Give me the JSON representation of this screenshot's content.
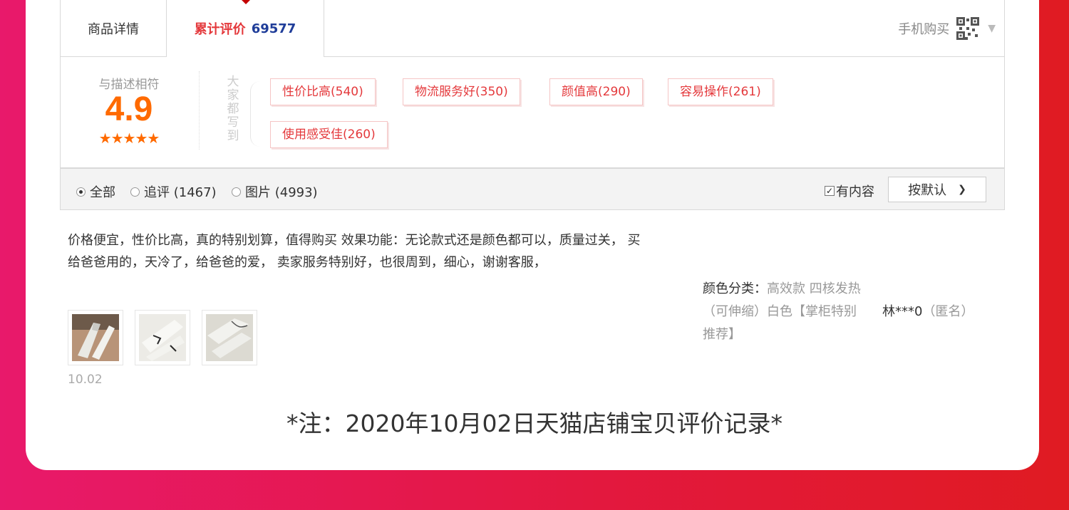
{
  "tabs": {
    "detail": "商品详情",
    "review_label": "累计评价",
    "review_count": "69577",
    "mobile_buy": "手机购买"
  },
  "rating": {
    "label": "与描述相符",
    "score": "4.9",
    "stars": "★★★★★",
    "stars_value": 5,
    "side_label": "大家都写到"
  },
  "tags": [
    {
      "text": "性价比高(540)"
    },
    {
      "text": "物流服务好(350)"
    },
    {
      "text": "颜值高(290)"
    },
    {
      "text": "容易操作(261)"
    },
    {
      "text": "使用感受佳(260)"
    }
  ],
  "filter": {
    "all": "全部",
    "followup": "追评 (1467)",
    "pictures": "图片 (4993)",
    "selected": "全部",
    "has_content": "有内容",
    "has_content_checked": true,
    "sort": "按默认"
  },
  "review": {
    "text": "价格便宜，性价比高，真的特别划算，值得购买 效果功能：无论款式还是颜色都可以，质量过关， 买给爸爸用的，天冷了，给爸爸的爱， 卖家服务特别好，也很周到，细心，谢谢客服，",
    "date": "10.02",
    "sku_label": "颜色分类：",
    "sku_value": "高效款 四核发热（可伸缩）白色【掌柜特别推荐】",
    "user": "林***0",
    "anon": "（匿名）"
  },
  "note": "*注：2020年10月02日天猫店铺宝贝评价记录*",
  "colors": {
    "accent": "#e4393c",
    "score": "#ff6a00",
    "count": "#1f3d99"
  }
}
